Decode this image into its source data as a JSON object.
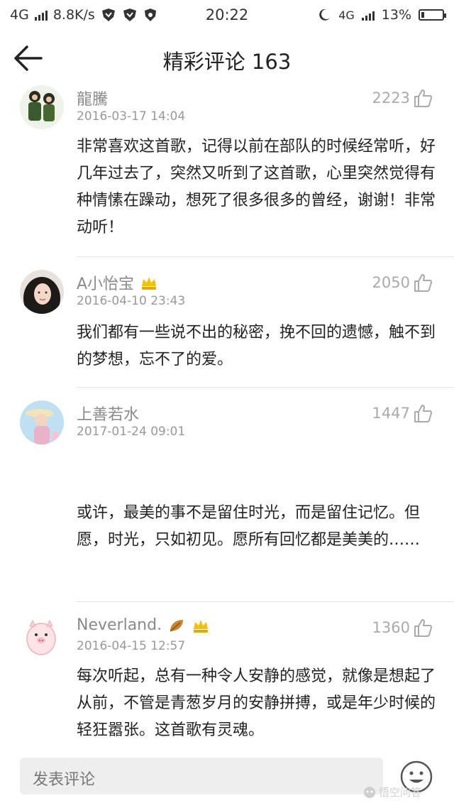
{
  "status_bar": {
    "network_left": "4G",
    "speed": "8.8K/s",
    "time": "20:22",
    "network_right": "4G",
    "battery": "13%",
    "battery_level": 0.13
  },
  "header": {
    "title": "精彩评论 163"
  },
  "comments": [
    {
      "username": "龍騰",
      "date": "2016-03-17 14:04",
      "likes": "2223",
      "text": "非常喜欢这首歌，记得以前在部队的时候经常听，好几年过去了，突然又听到了这首歌，心里突然觉得有种情愫在躁动，想死了很多很多的曾经，谢谢！非常动听！"
    },
    {
      "username": "A小怡宝",
      "date": "2016-04-10 23:43",
      "likes": "2050",
      "text": "我们都有一些说不出的秘密，挽不回的遗憾，触不到的梦想，忘不了的爱。"
    },
    {
      "username": "上善若水",
      "date": "2017-01-24 09:01",
      "likes": "1447",
      "text": "或许，最美的事不是留住时光，而是留住记忆。但愿，时光，只如初见。愿所有回忆都是美美的……"
    },
    {
      "username": "Neverland.",
      "date": "2016-04-15 12:57",
      "likes": "1360",
      "text": "每次听起，总有一种令人安静的感觉，就像是想起了从前，不管是青葱岁月的安静拼搏，或是年少时候的轻狂嚣张。这首歌有灵魂。"
    }
  ],
  "bottom_bar": {
    "input_placeholder": "发表评论",
    "watermark": "悟空问答"
  },
  "colors": {
    "accent_badge": "#f2c200",
    "muted_text": "#999999"
  }
}
